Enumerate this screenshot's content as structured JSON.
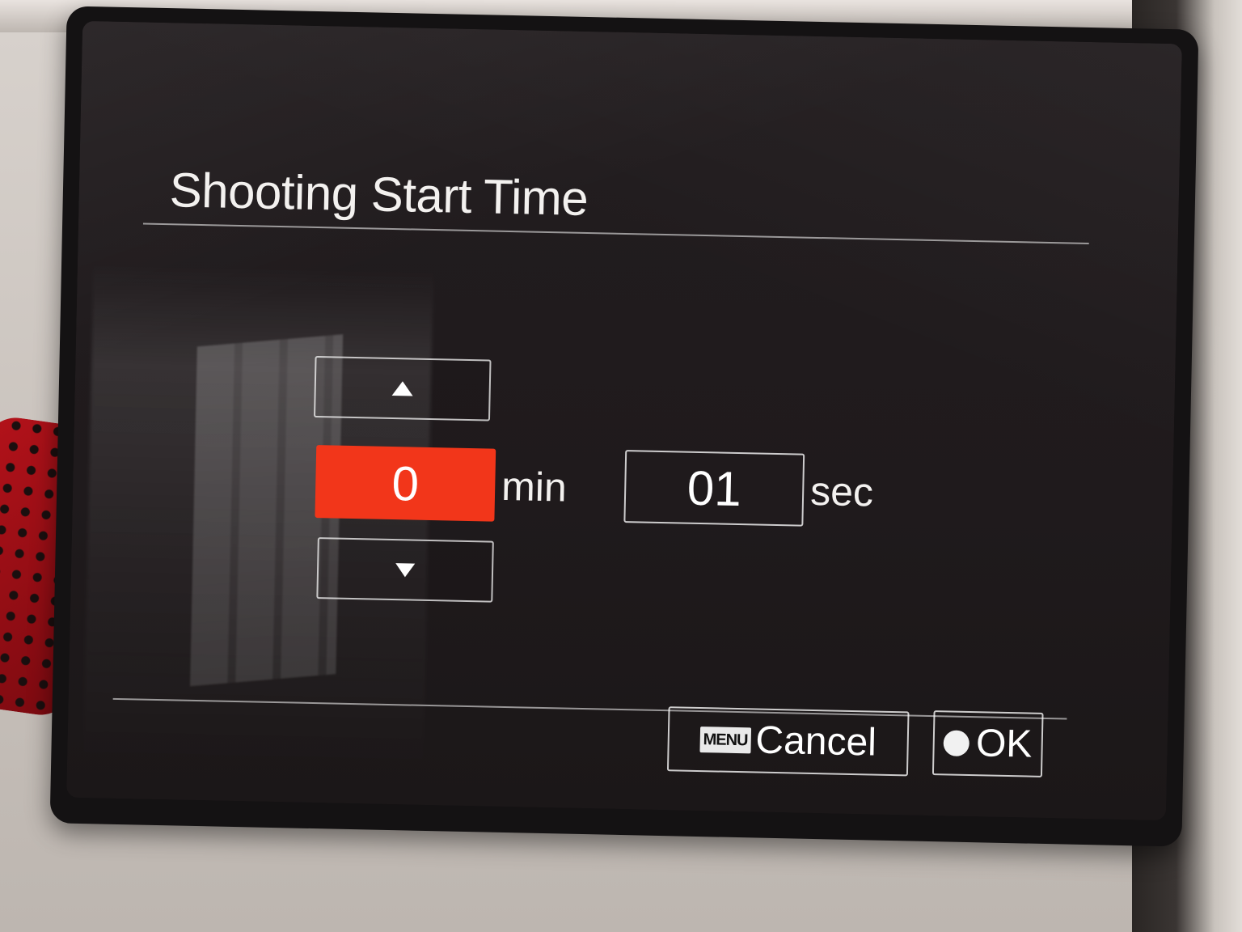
{
  "dialog": {
    "title": "Shooting Start Time"
  },
  "time_setting": {
    "minutes": {
      "value": "0",
      "unit": "min",
      "selected": true
    },
    "seconds": {
      "value": "01",
      "unit": "sec",
      "selected": false
    },
    "increment_icon": "triangle-up-icon",
    "decrement_icon": "triangle-down-icon"
  },
  "footer": {
    "cancel": {
      "badge": "MENU",
      "label": "Cancel"
    },
    "ok": {
      "icon": "filled-circle-icon",
      "label": "OK"
    }
  },
  "colors": {
    "selected_field": "#f2361a",
    "text": "#ffffff",
    "background": "#1f1a1c"
  }
}
